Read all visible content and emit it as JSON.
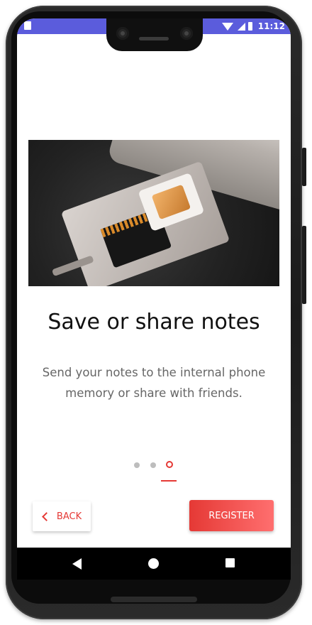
{
  "status_bar": {
    "time": "11:12",
    "color": "#5b5cdc",
    "icons": [
      "notification-icon",
      "wifi-icon",
      "signal-icon",
      "battery-icon"
    ]
  },
  "onboarding": {
    "image": "sim-card-tray-photo",
    "title": "Save or share notes",
    "description": "Send your notes to the internal phone memory or share with friends.",
    "page_indicator": {
      "total": 3,
      "active_index": 2
    }
  },
  "buttons": {
    "back_label": "BACK",
    "register_label": "REGISTER"
  },
  "colors": {
    "accent": "#e53935",
    "accent_gradient_end": "#ff6f6f",
    "title": "#111111",
    "description": "#666666"
  },
  "nav_bar": {
    "icons": [
      "back-triangle-icon",
      "home-circle-icon",
      "recents-square-icon"
    ]
  }
}
